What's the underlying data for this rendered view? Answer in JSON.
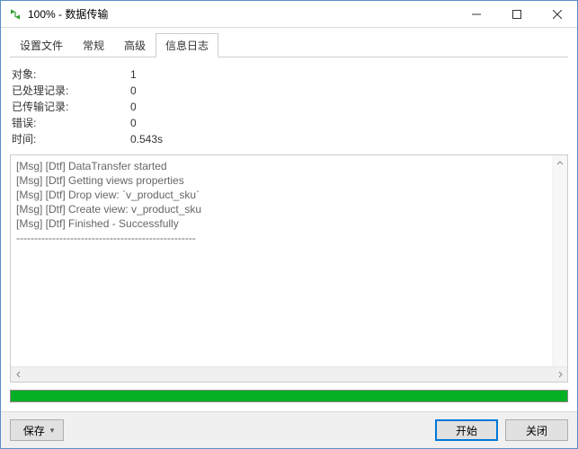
{
  "window": {
    "title": "100% - 数据传输"
  },
  "tabs": [
    {
      "label": "设置文件",
      "active": false
    },
    {
      "label": "常规",
      "active": false
    },
    {
      "label": "高级",
      "active": false
    },
    {
      "label": "信息日志",
      "active": true
    }
  ],
  "stats": {
    "objects_label": "对象:",
    "objects_value": "1",
    "processed_label": "已处理记录:",
    "processed_value": "0",
    "transferred_label": "已传输记录:",
    "transferred_value": "0",
    "errors_label": "错误:",
    "errors_value": "0",
    "time_label": "时间:",
    "time_value": "0.543s"
  },
  "log": {
    "lines": [
      "[Msg] [Dtf] DataTransfer started",
      "[Msg] [Dtf] Getting views properties",
      "[Msg] [Dtf] Drop view: `v_product_sku`",
      "[Msg] [Dtf] Create view: v_product_sku",
      "[Msg] [Dtf] Finished - Successfully",
      "--------------------------------------------------"
    ]
  },
  "progress": {
    "percent": 100,
    "bar_color": "#06b025"
  },
  "footer": {
    "save_label": "保存",
    "start_label": "开始",
    "close_label": "关闭"
  }
}
